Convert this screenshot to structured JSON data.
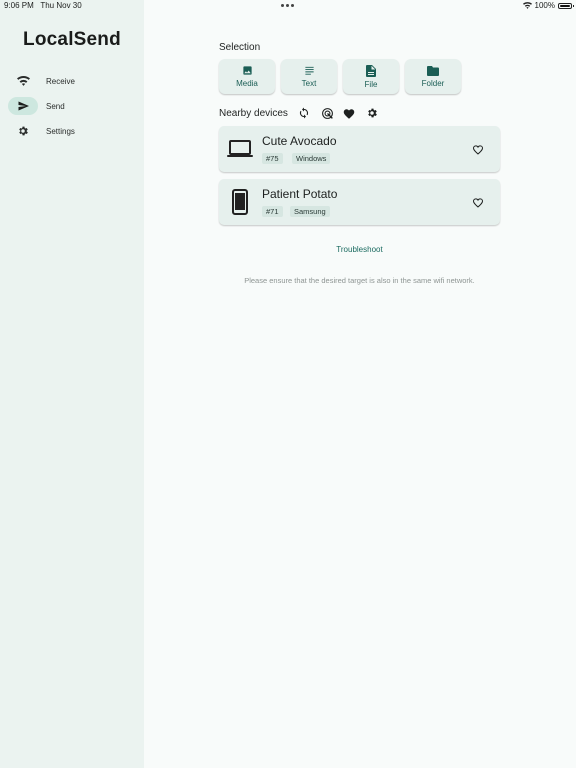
{
  "status_bar": {
    "time": "9:06 PM",
    "date": "Thu Nov 30",
    "battery": "100%"
  },
  "app": {
    "title": "LocalSend"
  },
  "nav": [
    {
      "label": "Receive",
      "icon": "wifi-icon",
      "active": false
    },
    {
      "label": "Send",
      "icon": "send-icon",
      "active": true
    },
    {
      "label": "Settings",
      "icon": "gear-icon",
      "active": false
    }
  ],
  "selection": {
    "heading": "Selection",
    "buttons": [
      {
        "label": "Media",
        "icon": "image-icon"
      },
      {
        "label": "Text",
        "icon": "text-icon"
      },
      {
        "label": "File",
        "icon": "file-icon"
      },
      {
        "label": "Folder",
        "icon": "folder-icon"
      }
    ]
  },
  "nearby": {
    "heading": "Nearby devices",
    "actions": [
      "refresh-icon",
      "scan-icon",
      "favorites-icon",
      "settings-icon"
    ]
  },
  "devices": [
    {
      "name": "Cute Avocado",
      "id": "#75",
      "platform": "Windows",
      "type": "laptop-icon"
    },
    {
      "name": "Patient Potato",
      "id": "#71",
      "platform": "Samsung",
      "type": "phone-icon"
    }
  ],
  "troubleshoot_label": "Troubleshoot",
  "hint": "Please ensure that the desired target is also in the same wifi network.",
  "colors": {
    "accent": "#1b6b60",
    "sidebar_bg": "#ebf3f0",
    "card_bg": "#e6f0ed",
    "active_pill": "#cde7df"
  }
}
